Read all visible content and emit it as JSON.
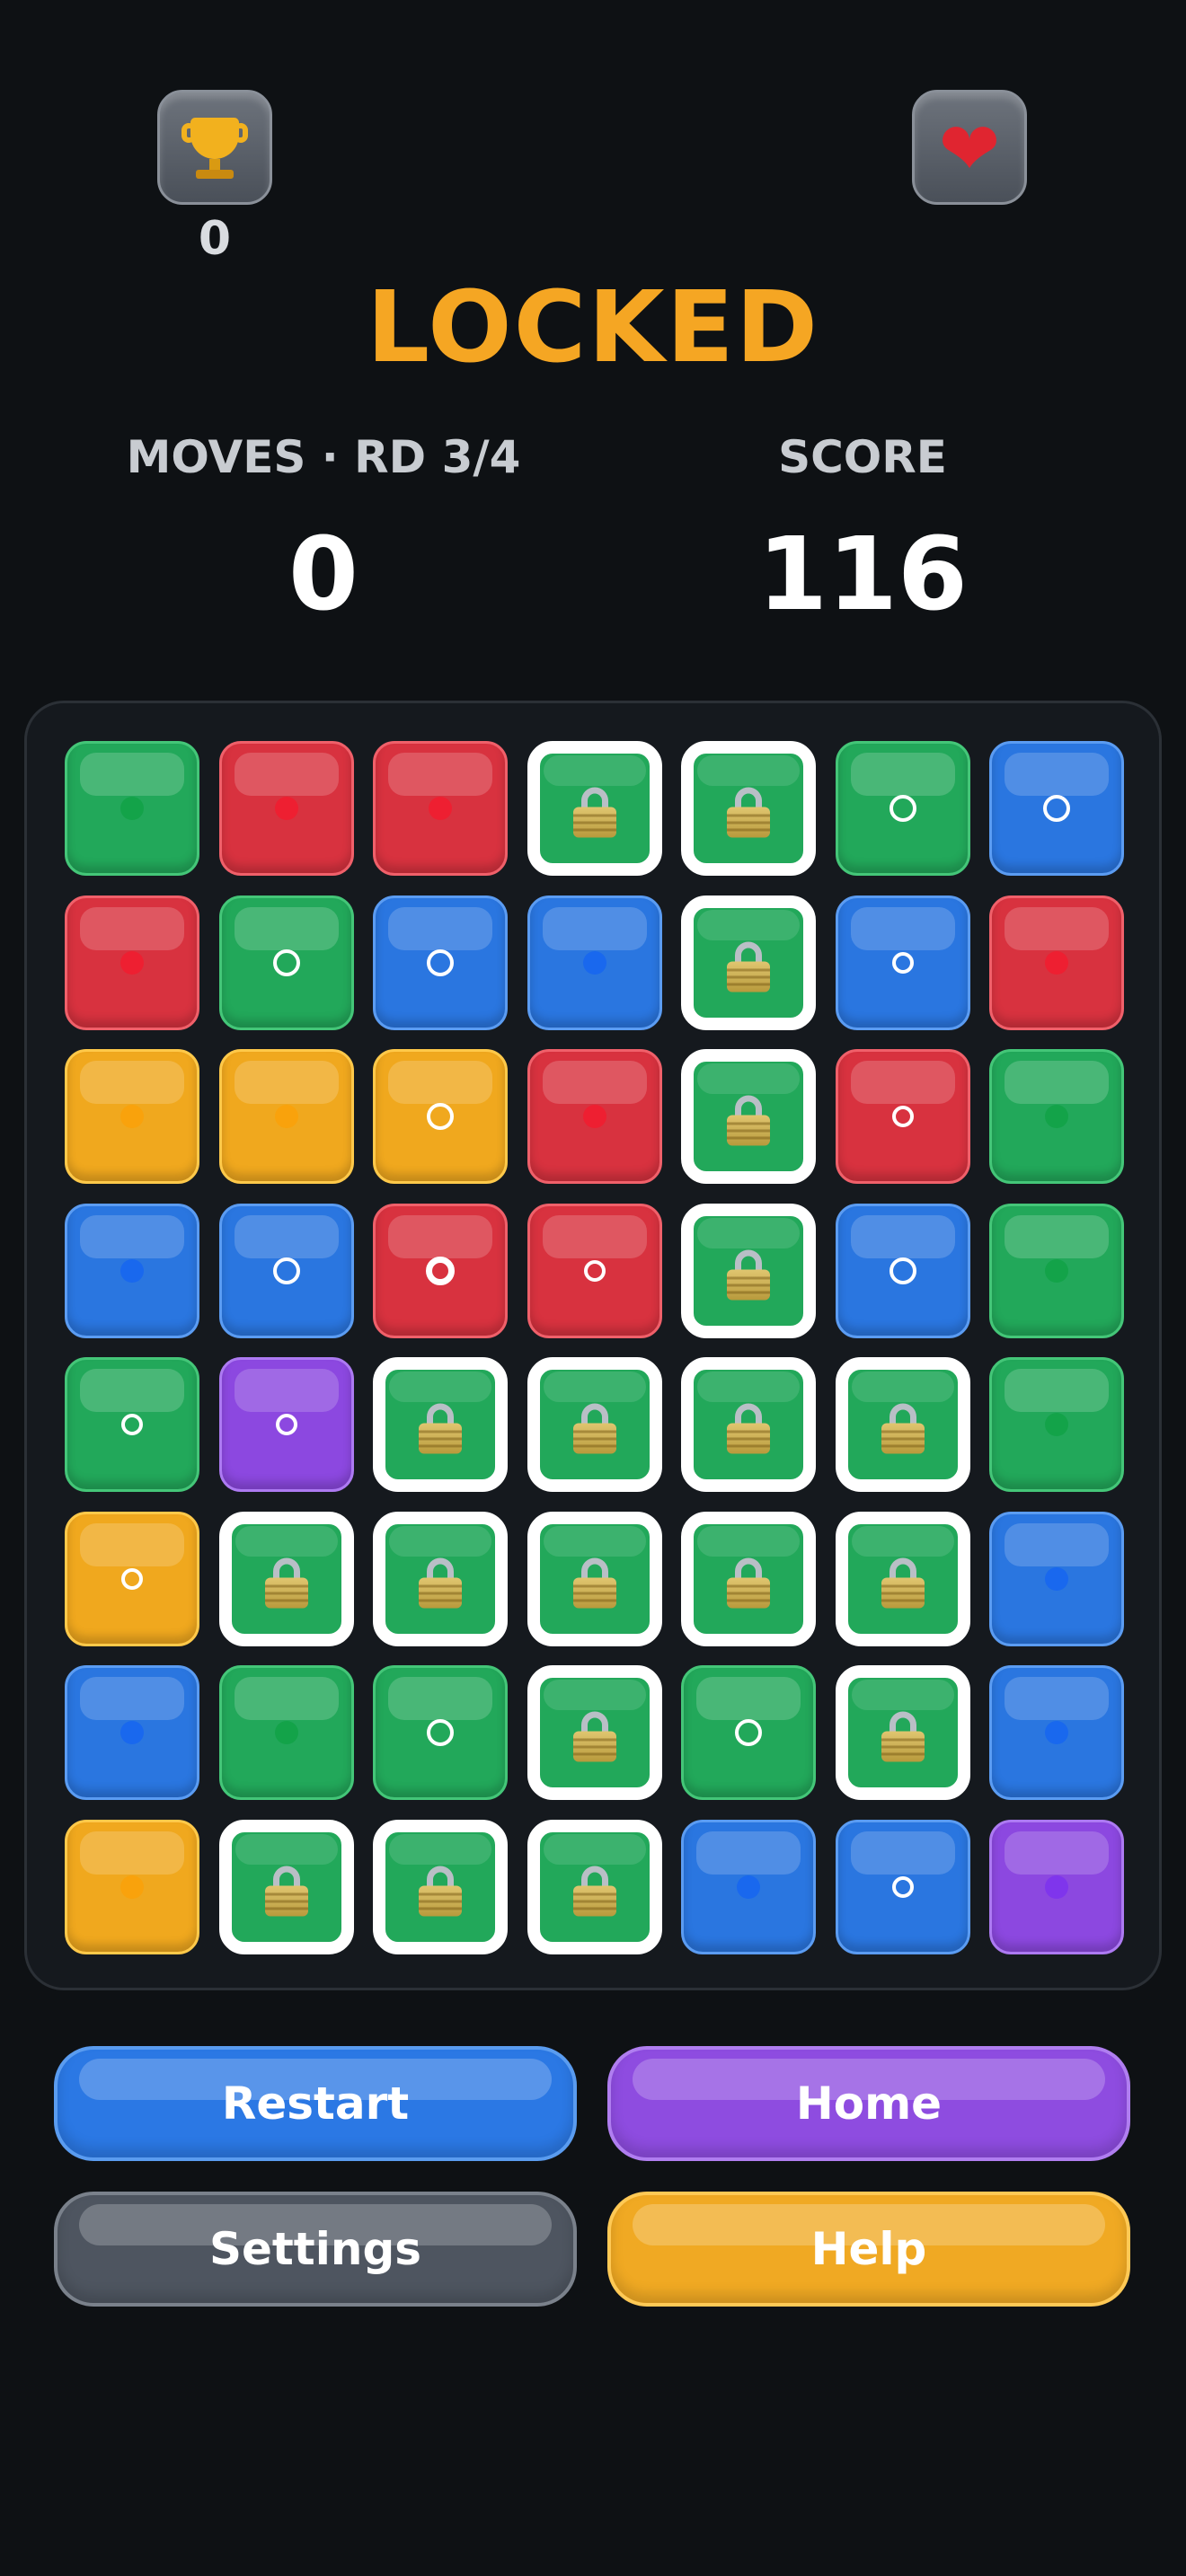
{
  "header": {
    "trophy_icon": "trophy-icon",
    "trophy_count": "0",
    "lives_icon": "heart-icon",
    "title": "LOCKED"
  },
  "stats": {
    "moves_label": "MOVES · RD 3/4",
    "moves_value": "0",
    "score_label": "SCORE",
    "score_value": "116"
  },
  "colors": {
    "green": "#22a85a",
    "red": "#d8323f",
    "blue": "#2a76e0",
    "yellow": "#f0a81e",
    "purple": "#8c48e0",
    "title": "#f5a623",
    "background": "#0e1114"
  },
  "board": {
    "rows": 8,
    "cols": 7,
    "legend": "tile format: color:marker where marker is dot (filled dot), ring (white ring), ring-thick, ring-small; 'locked' = locked tile with padlock",
    "tiles": [
      [
        "green:dot",
        "red:dot",
        "red:dot",
        "locked",
        "locked",
        "green:ring",
        "blue:ring"
      ],
      [
        "red:dot",
        "green:ring",
        "blue:ring",
        "blue:dot",
        "locked",
        "blue:ring-small",
        "red:dot"
      ],
      [
        "yellow:dot",
        "yellow:dot",
        "yellow:ring",
        "red:dot",
        "locked",
        "red:ring-small",
        "green:dot"
      ],
      [
        "blue:dot",
        "blue:ring",
        "red:ring-thick",
        "red:ring-small",
        "locked",
        "blue:ring",
        "green:dot"
      ],
      [
        "green:ring-small",
        "purple:ring-small",
        "locked",
        "locked",
        "locked",
        "locked",
        "green:dot"
      ],
      [
        "yellow:ring-small",
        "locked",
        "locked",
        "locked",
        "locked",
        "locked",
        "blue:dot"
      ],
      [
        "blue:dot",
        "green:dot",
        "green:ring",
        "locked",
        "green:ring",
        "locked",
        "blue:dot"
      ],
      [
        "yellow:dot",
        "locked",
        "locked",
        "locked",
        "blue:dot",
        "blue:ring-small",
        "purple:dot"
      ]
    ]
  },
  "buttons": {
    "restart": "Restart",
    "home": "Home",
    "settings": "Settings",
    "help": "Help"
  }
}
